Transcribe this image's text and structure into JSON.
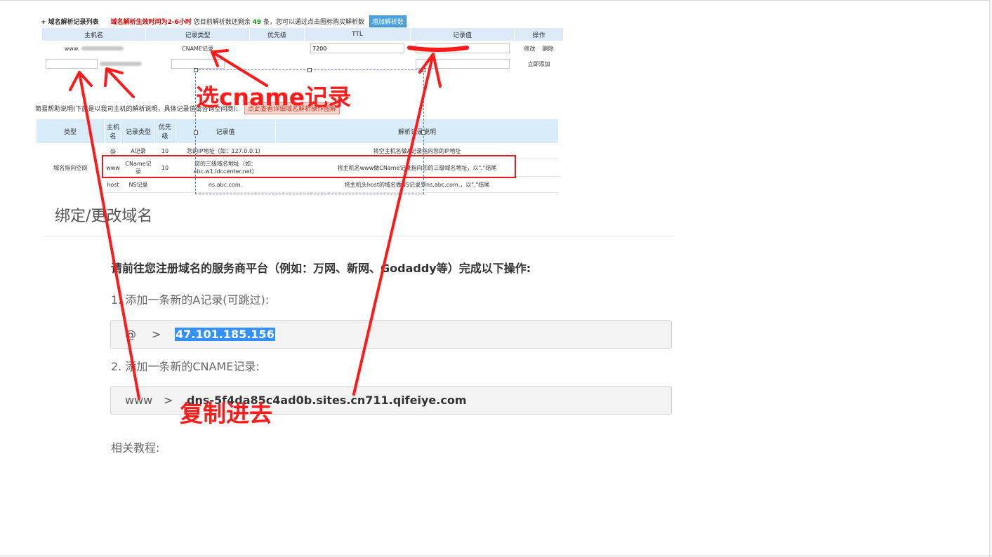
{
  "screenshot": {
    "header": {
      "title": "+ 域名解析记录列表",
      "warning": "域名解析生效时间为2-6小时",
      "remain_prefix": "您目前解析数还剩余",
      "remain_count": "49",
      "remain_suffix": "条，您可以通过点击图标购买解析数",
      "add_button": "增加解析数"
    },
    "record_table": {
      "headers": [
        "主机名",
        "记录类型",
        "优先级",
        "TTL",
        "记录值",
        "操作"
      ],
      "row1": {
        "host": "www.",
        "type": "CNAME记录",
        "ttl": "7200",
        "edit": "修改",
        "delete": "删除"
      },
      "row2": {
        "action": "立即添加"
      }
    },
    "help": {
      "text": "简易帮助说明(下面是以我司主机的解析说明，具体记录值请咨询空间商):",
      "button": "点此查看详细域名解析操作图解"
    },
    "help_table": {
      "headers": [
        "类型",
        "主机名",
        "记录类型",
        "优先级",
        "记录值",
        "解析记录说明"
      ],
      "group_label": "域名指向空间",
      "rows": [
        {
          "host": "@",
          "type": "A记录",
          "priority": "10",
          "value": "您的IP地址（如：127.0.0.1）",
          "desc": "将空主机名做A记录指向您的IP地址"
        },
        {
          "host": "www",
          "type": "CName记录",
          "priority": "10",
          "value": "您的三级域名地址（如：abc.w1.idccenter.net）",
          "desc": "将主机名www做CName记录指向您的三级域名地址，以\".\"结尾"
        },
        {
          "host": "host",
          "type": "NS记录",
          "priority": "",
          "value": "ns.abc.com.",
          "desc": "将主机头host的域名做NS记录到ns.abc.com.，以\".\"结尾"
        }
      ]
    }
  },
  "page": {
    "title": "绑定/更改域名",
    "instruction": "请前往您注册域名的服务商平台（例如：万网、新网、Godaddy等）完成以下操作:",
    "step1": "1. 添加一条新的A记录(可跳过):",
    "a_record": {
      "host": "@",
      "arrow": ">",
      "value": "47.101.185.156"
    },
    "step2": "2. 添加一条新的CNAME记录:",
    "cname_record": {
      "host": "www",
      "arrow": ">",
      "value": "dns-5f4da85c4ad0b.sites.cn711.qifeiye.com"
    },
    "related": "相关教程:"
  },
  "annotations": {
    "select_cname": "选cname记录",
    "copy_in": "复制进去",
    "color": "#ff1a1a"
  }
}
